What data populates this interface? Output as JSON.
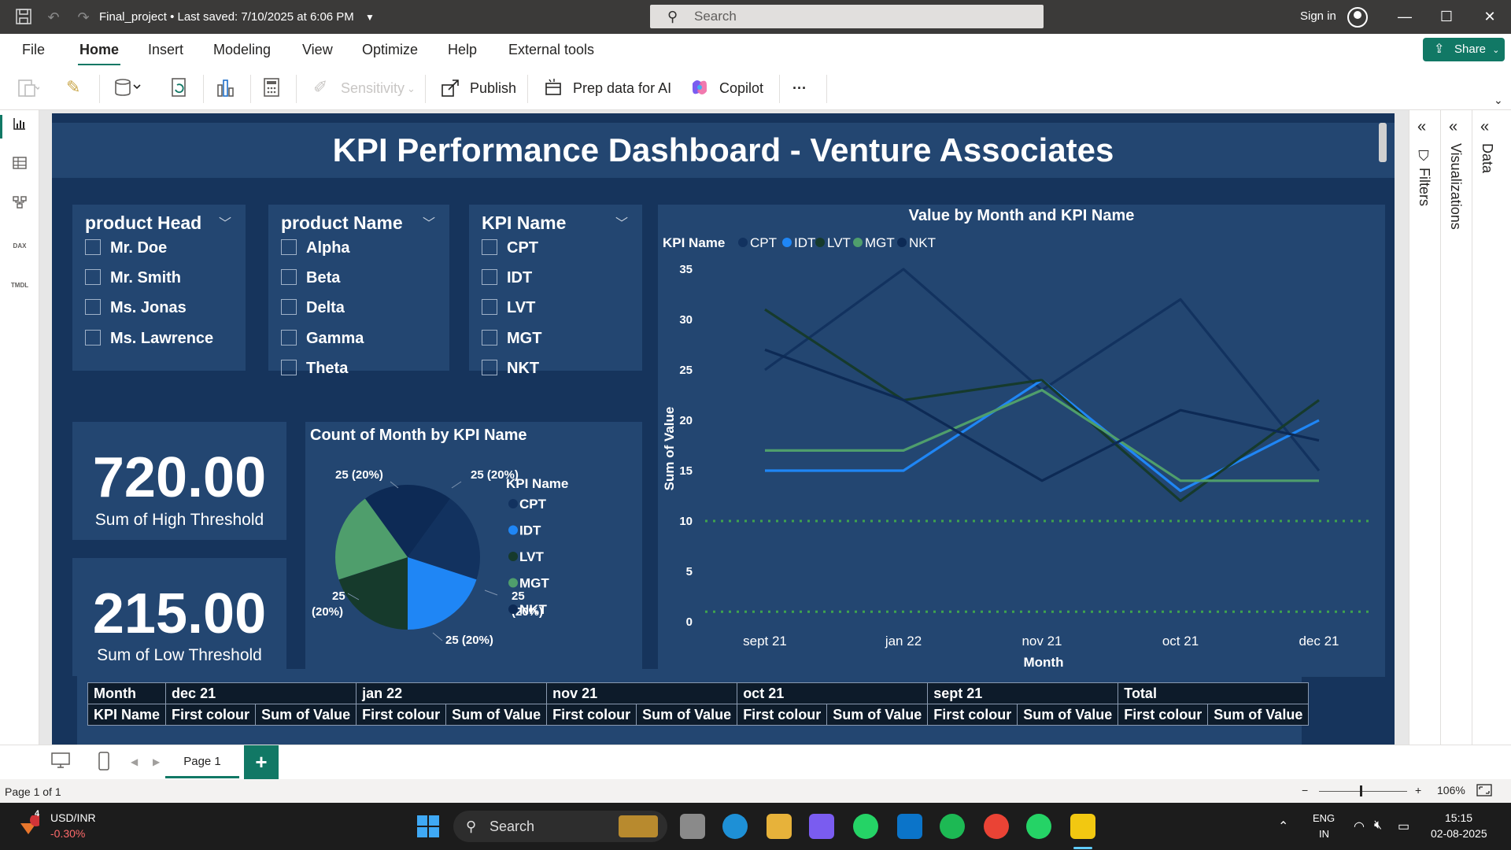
{
  "titlebar": {
    "title": "Final_project",
    "saved": "Last saved: 7/10/2025 at 6:06 PM",
    "search_placeholder": "Search",
    "signin": "Sign in"
  },
  "menu": {
    "items": [
      "File",
      "Home",
      "Insert",
      "Modeling",
      "View",
      "Optimize",
      "Help",
      "External tools"
    ],
    "active": "Home",
    "share": "Share"
  },
  "ribbon": {
    "sensitivity": "Sensitivity",
    "publish": "Publish",
    "prep_ai": "Prep data for AI",
    "copilot": "Copilot",
    "more": "···"
  },
  "report": {
    "title": "KPI Performance Dashboard - Venture Associates",
    "slicers": [
      {
        "title": "product Head",
        "items": [
          "Mr. Doe",
          "Mr. Smith",
          "Ms. Jonas",
          "Ms. Lawrence"
        ]
      },
      {
        "title": "product Name",
        "items": [
          "Alpha",
          "Beta",
          "Delta",
          "Gamma",
          "Theta"
        ]
      },
      {
        "title": "KPI Name",
        "items": [
          "CPT",
          "IDT",
          "LVT",
          "MGT",
          "NKT"
        ]
      }
    ],
    "cards": [
      {
        "value": "720.00",
        "label": "Sum of High Threshold"
      },
      {
        "value": "215.00",
        "label": "Sum of Low Threshold"
      }
    ],
    "matrix": {
      "row1": [
        "Month",
        "dec 21",
        "jan 22",
        "nov 21",
        "oct 21",
        "sept 21",
        "Total"
      ],
      "row2": [
        "KPI Name",
        "First colour",
        "Sum of Value",
        "First colour",
        "Sum of Value",
        "First colour",
        "Sum of Value",
        "First colour",
        "Sum of Value",
        "First colour",
        "Sum of Value",
        "First colour",
        "Sum of Value"
      ]
    }
  },
  "chart_data": [
    {
      "type": "pie",
      "title": "Count of Month by KPI Name",
      "legend_title": "KPI Name",
      "legend_position": "right",
      "categories": [
        "CPT",
        "IDT",
        "LVT",
        "MGT",
        "NKT"
      ],
      "values": [
        25,
        25,
        25,
        25,
        25
      ],
      "labels": [
        "25 (20%)",
        "25 (20%)",
        "25 (20%)",
        "25 (20%)",
        "25 (20%)"
      ],
      "colors": [
        "#12325f",
        "#1f86f5",
        "#163a2c",
        "#4f9e6c",
        "#0d2a55"
      ]
    },
    {
      "type": "line",
      "title": "Value by Month and KPI Name",
      "legend_title": "KPI Name",
      "legend_position": "top-left",
      "xlabel": "Month",
      "ylabel": "Sum of Value",
      "categories": [
        "sept 21",
        "jan 22",
        "nov 21",
        "oct 21",
        "dec 21"
      ],
      "ylim": [
        0,
        35
      ],
      "yticks": [
        "0",
        "5",
        "10",
        "15",
        "20",
        "25",
        "30",
        "35"
      ],
      "series": [
        {
          "name": "CPT",
          "values": [
            25,
            35,
            23,
            32,
            15
          ],
          "color": "#12325f"
        },
        {
          "name": "IDT",
          "values": [
            15,
            15,
            24,
            13,
            20
          ],
          "color": "#1f86f5"
        },
        {
          "name": "LVT",
          "values": [
            31,
            22,
            24,
            12,
            22
          ],
          "color": "#163a2c"
        },
        {
          "name": "MGT",
          "values": [
            17,
            17,
            23,
            14,
            14
          ],
          "color": "#4f9e6c"
        },
        {
          "name": "NKT",
          "values": [
            27,
            22,
            14,
            21,
            18
          ],
          "color": "#0d2a55"
        }
      ],
      "reference_lines": [
        {
          "value": 10,
          "color": "#3fa34d",
          "style": "dotted"
        },
        {
          "value": 1,
          "color": "#3fa34d",
          "style": "dotted"
        }
      ]
    }
  ],
  "panes": {
    "filters": "Filters",
    "visualizations": "Visualizations",
    "data": "Data"
  },
  "pages": {
    "tab": "Page 1",
    "add": "+",
    "status": "Page 1 of 1",
    "zoom": "106%"
  },
  "taskbar": {
    "ticker": "USD/INR",
    "change": "-0.30%",
    "badge": "4",
    "search": "Search",
    "lang1": "ENG",
    "lang2": "IN",
    "time": "15:15",
    "date": "02-08-2025"
  }
}
